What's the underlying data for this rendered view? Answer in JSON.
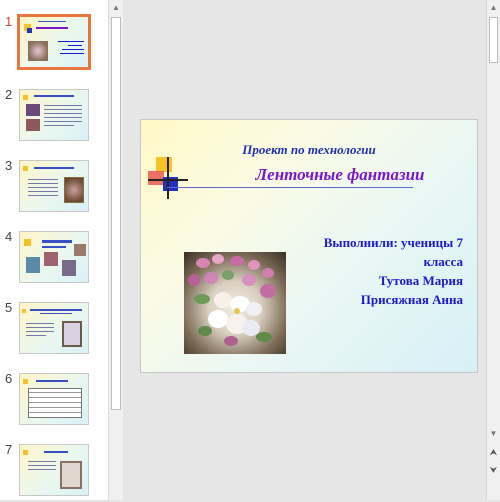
{
  "thumbnails": [
    {
      "number": "1",
      "selected": true
    },
    {
      "number": "2",
      "selected": false
    },
    {
      "number": "3",
      "selected": false
    },
    {
      "number": "4",
      "selected": false
    },
    {
      "number": "5",
      "selected": false
    },
    {
      "number": "6",
      "selected": false
    },
    {
      "number": "7",
      "selected": false
    }
  ],
  "slide": {
    "subtitle": "Проект по технологии",
    "title": "Ленточные фантазии",
    "author_lines": [
      "Выполнили: ученицы 7",
      "класса",
      "Тутова Мария",
      "Присяжная Анна"
    ]
  },
  "icons": {
    "scroll_up": "scroll-up-icon",
    "scroll_down": "scroll-down-icon",
    "prev_slide": "double-up-chevron-icon",
    "next_slide": "double-down-chevron-icon"
  },
  "colors": {
    "selected_thumb_border": "#e8763e",
    "title": "#7a17c9",
    "subtitle": "#1f2fb0",
    "author_text": "#1a1ac8"
  }
}
